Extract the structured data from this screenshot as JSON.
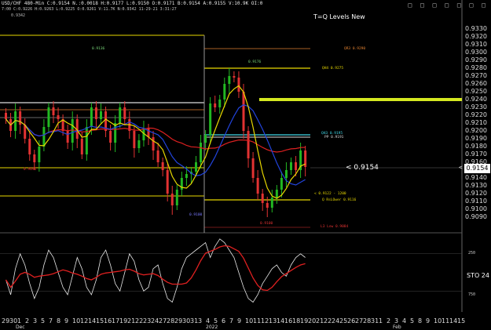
{
  "header": {
    "line1": "USD/CHF 480-Min C:0.9154 N.:0.0018 H:0.9177 L:0.9150 O:0.9171 B:0.9154 A:0.9155 V:10.9K OI:0",
    "line2": "7:00 C:0.9226 H:0.9263 L:0.9225 O:0.9261 V:11.7K N:0.9342 11-29-21 3:31:27",
    "line3": "0.9342",
    "window_icons": "□ □ □ □ □ □ □"
  },
  "chart_title": "T=Q Levels New",
  "price_axis": [
    "0.9330",
    "0.9320",
    "0.9310",
    "0.9300",
    "0.9290",
    "0.9280",
    "0.9270",
    "0.9260",
    "0.9250",
    "0.9240",
    "0.9230",
    "0.9220",
    "0.9210",
    "0.9200",
    "0.9190",
    "0.9180",
    "0.9170",
    "0.9160",
    "0.9150",
    "0.9140",
    "0.9130",
    "0.9120",
    "0.9110",
    "0.9100",
    "0.9090"
  ],
  "current_price": "0.9154",
  "current_price_label": "< 0.9154",
  "price_arrow": "<",
  "annotations": {
    "t1": "0.9136",
    "t2": "0.9176",
    "qr3": "QR3 0.9290",
    "qh4": "QH4 0.9275",
    "qh3": "QH3 0.9195",
    "pp": "PP 0.9191",
    "low_a": "0.9091",
    "low_b": "0.9100",
    "lvl_a": "< 0.9122 - 1200",
    "lvl_b": "Q RsLOwer 0.9116",
    "low_c": "0.9100",
    "low_d": "L3 Low 0.9084"
  },
  "stoch": {
    "name": "STO 24",
    "levels": [
      "250",
      "100",
      "750"
    ]
  },
  "x_axis": {
    "days": [
      "29",
      "30",
      "1",
      "2",
      "3",
      "5",
      "7",
      "8",
      "9",
      "10",
      "12",
      "14",
      "15",
      "16",
      "17",
      "19",
      "21",
      "22",
      "23",
      "24",
      "27",
      "28",
      "29",
      "30",
      "31",
      "3",
      "4",
      "5",
      "6",
      "7",
      "9",
      "10",
      "11",
      "12",
      "13",
      "14",
      "16",
      "18",
      "19",
      "20",
      "21",
      "22",
      "24",
      "25",
      "26",
      "27",
      "28",
      "31",
      "1",
      "2",
      "3",
      "4",
      "5",
      "8",
      "9",
      "10",
      "11",
      "14",
      "15"
    ],
    "months": [
      "Dec",
      "2022",
      "Feb"
    ]
  },
  "colors": {
    "up_candle": "#22b822",
    "down_candle": "#e23232",
    "ma_yellow": "#e8d800",
    "ma_blue": "#2244dd",
    "ma_red": "#dd2020",
    "level_yellow": "#d8d818",
    "pp_cyan": "#40d8e8"
  },
  "chart_data": {
    "type": "candlestick",
    "symbol": "USD/CHF",
    "interval": "480-Min",
    "ylim": [
      0.9082,
      0.934
    ],
    "closes": [
      0.9215,
      0.92,
      0.9225,
      0.9208,
      0.919,
      0.917,
      0.916,
      0.918,
      0.9205,
      0.923,
      0.922,
      0.9215,
      0.92,
      0.9185,
      0.9215,
      0.919,
      0.917,
      0.9205,
      0.923,
      0.9215,
      0.9225,
      0.92,
      0.9185,
      0.921,
      0.923,
      0.9215,
      0.92,
      0.9178,
      0.9188,
      0.9203,
      0.9192,
      0.9175,
      0.916,
      0.915,
      0.912,
      0.9105,
      0.9125,
      0.914,
      0.9145,
      0.9148,
      0.916,
      0.9185,
      0.9195,
      0.9235,
      0.923,
      0.924,
      0.926,
      0.927,
      0.9268,
      0.925,
      0.92,
      0.9165,
      0.914,
      0.912,
      0.9108,
      0.9102,
      0.9115,
      0.9125,
      0.914,
      0.915,
      0.916,
      0.915,
      0.9175,
      0.9154
    ]
  }
}
